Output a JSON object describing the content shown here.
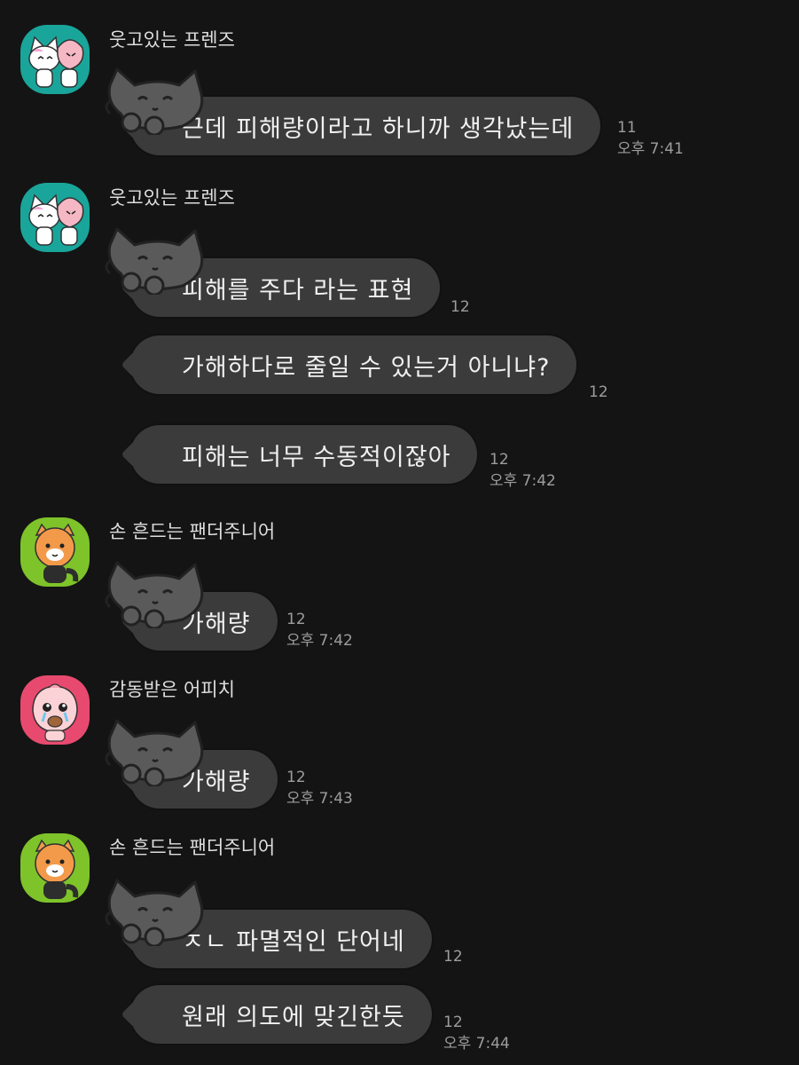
{
  "messages": [
    {
      "sender": "웃고있는 프렌즈",
      "avatar": "cat-peach-friends-icon",
      "text": "근데 피해량이라고 하니까 생각났는데",
      "unread": "11",
      "time": "오후 7:41"
    },
    {
      "sender": "웃고있는 프렌즈",
      "avatar": "cat-peach-friends-icon",
      "text": "피해를 주다 라는 표현",
      "unread": "12"
    },
    {
      "text": "가해하다로 줄일 수 있는거 아니냐?",
      "unread": "12"
    },
    {
      "text": "피해는 너무 수동적이잖아",
      "unread": "12",
      "time": "오후 7:42"
    },
    {
      "sender": "손 흔드는 팬더주니어",
      "avatar": "panda-junior-icon",
      "text": "가해량",
      "unread": "12",
      "time": "오후 7:42"
    },
    {
      "sender": "감동받은 어피치",
      "avatar": "crying-apeach-icon",
      "text": "가해량",
      "unread": "12",
      "time": "오후 7:43"
    },
    {
      "sender": "손 흔드는 팬더주니어",
      "avatar": "panda-junior-icon",
      "text": "ㅈㄴ 파멸적인 단어네",
      "unread": "12"
    },
    {
      "text": "원래 의도에 맞긴한듯",
      "unread": "12",
      "time": "오후 7:44"
    }
  ],
  "colors": {
    "background": "#141414",
    "bubble": "#3b3b3b",
    "avatar_teal": "#1aa59a",
    "avatar_green": "#7ec32a",
    "avatar_pink": "#e84a6f"
  }
}
